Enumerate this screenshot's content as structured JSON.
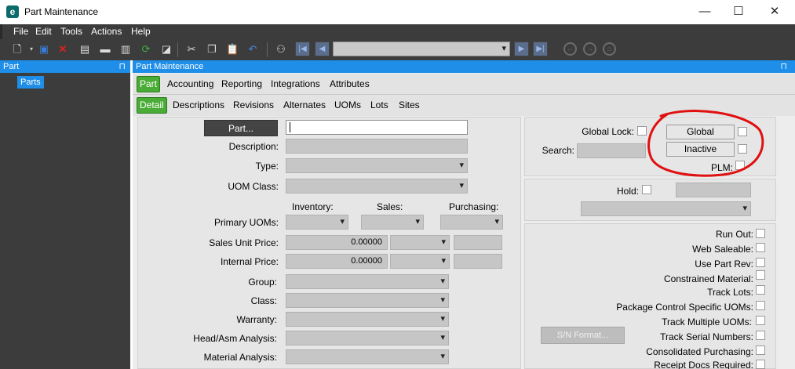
{
  "window": {
    "title": "Part Maintenance",
    "minimize": "—",
    "maximize": "☐",
    "close": "✕"
  },
  "menu": [
    "File",
    "Edit",
    "Tools",
    "Actions",
    "Help"
  ],
  "left_pane": {
    "header": "Part",
    "pin": "⊓",
    "items": [
      "Parts"
    ]
  },
  "main_pane": {
    "header": "Part Maintenance",
    "pin": "⊓",
    "tabs_level1": [
      "Part",
      "Accounting",
      "Reporting",
      "Integrations",
      "Attributes"
    ],
    "tabs_level2": [
      "Detail",
      "Descriptions",
      "Revisions",
      "Alternates",
      "UOMs",
      "Lots",
      "Sites"
    ],
    "active_tab_level1": "Part",
    "active_tab_level2": "Detail"
  },
  "detail": {
    "part_button": "Part...",
    "part_value": "",
    "description_label": "Description:",
    "type_label": "Type:",
    "uom_class_label": "UOM Class:",
    "uom_headers": [
      "Inventory:",
      "Sales:",
      "Purchasing:"
    ],
    "primary_uoms_label": "Primary UOMs:",
    "sales_unit_price_label": "Sales Unit Price:",
    "sales_unit_price_value": "0.00000",
    "internal_price_label": "Internal Price:",
    "internal_price_value": "0.00000",
    "group_label": "Group:",
    "class_label": "Class:",
    "warranty_label": "Warranty:",
    "head_asm_label": "Head/Asm Analysis:",
    "material_analysis_label": "Material Analysis:"
  },
  "right_top": {
    "global_lock_label": "Global Lock:",
    "search_label": "Search:",
    "global_button": "Global",
    "inactive_button": "Inactive",
    "plm_label": "PLM:",
    "highlight_color": "#e01010"
  },
  "right_mid": {
    "hold_label": "Hold:"
  },
  "right_bottom": {
    "sn_format_button": "S/N Format...",
    "checkboxes": [
      "Run Out:",
      "Web Saleable:",
      "Use Part Rev:",
      "Constrained Material:",
      "Track Lots:",
      "Package Control Specific UOMs:",
      "Track Multiple UOMs:",
      "Track Serial Numbers:",
      "Consolidated Purchasing:",
      "Receipt Docs Required:"
    ]
  },
  "colors": {
    "accent": "#1e8ee8",
    "active_tab": "#4aab36",
    "dark_bg": "#3c3c3c"
  }
}
